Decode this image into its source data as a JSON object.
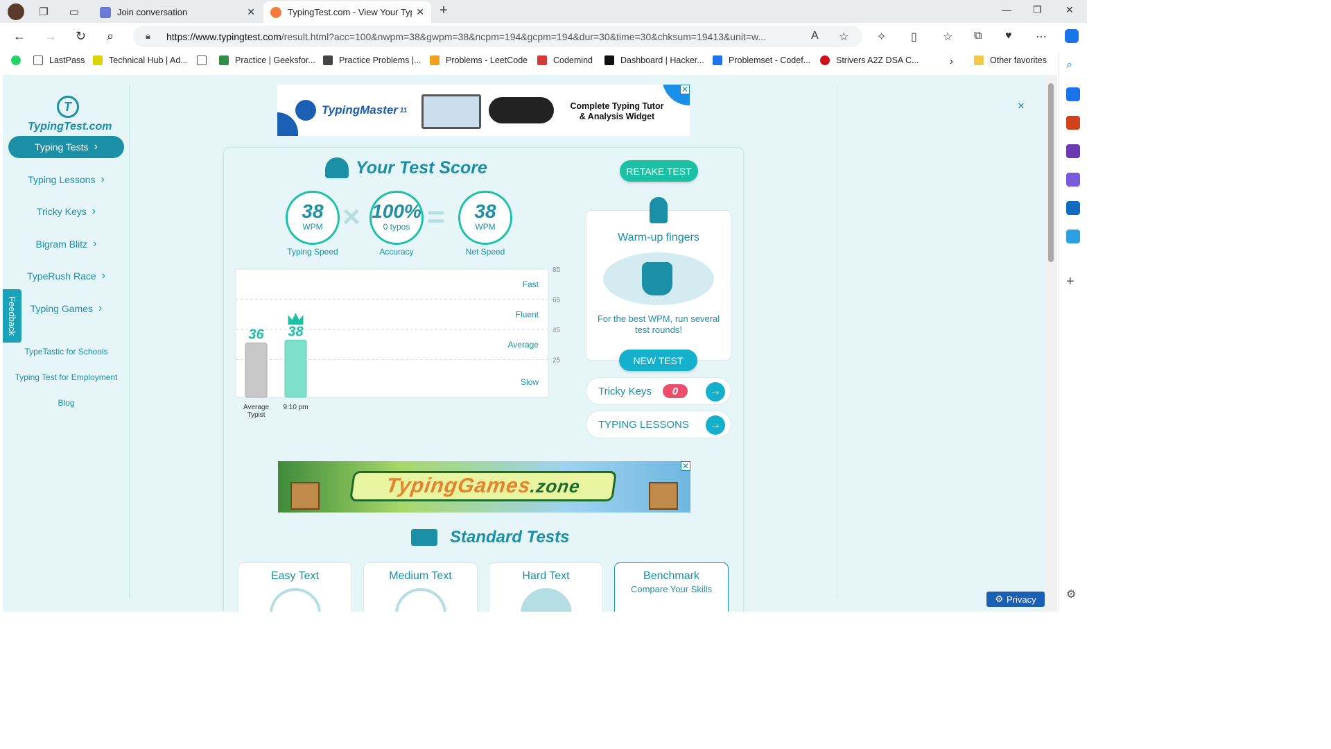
{
  "browser": {
    "tabs": [
      {
        "title": "Join conversation",
        "color": "#6b7ad6"
      },
      {
        "title": "TypingTest.com - View Your Typir",
        "color": "#ef7d3c"
      }
    ],
    "url_domain": "https://www.typingtest.com",
    "url_rest": "/result.html?acc=100&nwpm=38&gwpm=38&ncpm=194&gcpm=194&dur=30&time=30&chksum=19413&unit=w...",
    "bookmarks": [
      {
        "label": "LastPass",
        "color": "#555555"
      },
      {
        "label": "Technical Hub | Ad...",
        "color": "#d8d400"
      },
      {
        "label": "",
        "color": "#777777"
      },
      {
        "label": "Practice | Geeksfor...",
        "color": "#2f8d46"
      },
      {
        "label": "Practice Problems |...",
        "color": "#444444"
      },
      {
        "label": "Problems - LeetCode",
        "color": "#f0a020"
      },
      {
        "label": "Codemind",
        "color": "#d23a3a"
      },
      {
        "label": "Dashboard | Hacker...",
        "color": "#111111"
      },
      {
        "label": "Problemset - Codef...",
        "color": "#1a73e8"
      },
      {
        "label": "Strivers A2Z DSA C...",
        "color": "#d0101a"
      }
    ],
    "other_favorites": "Other favorites"
  },
  "sidebar": {
    "logo_text": "TypingTest.com",
    "logo_letter": "T",
    "items": [
      {
        "label": "Typing Tests",
        "arrow": "›"
      },
      {
        "label": "Typing Lessons",
        "arrow": "›"
      },
      {
        "label": "Tricky Keys",
        "arrow": "›"
      },
      {
        "label": "Bigram Blitz",
        "arrow": "›"
      },
      {
        "label": "TypeRush Race",
        "arrow": "›"
      },
      {
        "label": "Typing Games",
        "arrow": "›"
      }
    ],
    "links": [
      "TypeTastic for Schools",
      "Typing Test for Employment",
      "Blog"
    ],
    "feedback": "Feedback"
  },
  "ad_top": {
    "brand": "TypingMaster",
    "version": "11",
    "copy_line1": "Complete Typing Tutor",
    "copy_line2": "& Analysis Widget"
  },
  "score": {
    "title": "Your Test Score",
    "retake": "RETAKE TEST",
    "stats": [
      {
        "value": "38",
        "unit": "WPM",
        "label": "Typing Speed"
      },
      {
        "value": "100%",
        "unit": "0 typos",
        "label": "Accuracy"
      },
      {
        "value": "38",
        "unit": "WPM",
        "label": "Net Speed"
      }
    ]
  },
  "chart_data": {
    "type": "bar",
    "categories": [
      "Average Typist",
      "9:10 pm"
    ],
    "values": [
      36,
      38
    ],
    "ylim": [
      0,
      85
    ],
    "right_ticks": [
      85,
      65,
      45,
      25
    ],
    "bands": [
      "Fast",
      "Fluent",
      "Average",
      "Slow"
    ],
    "bar_colors": [
      "#c8c8c8",
      "#7ee0c9"
    ],
    "grid": true
  },
  "warmup": {
    "title": "Warm-up fingers",
    "desc": "For the best WPM, run several test rounds!",
    "button": "NEW TEST"
  },
  "links": {
    "tricky_keys": "Tricky Keys",
    "tricky_count": "0",
    "lessons": "TYPING LESSONS"
  },
  "ad_games": {
    "brand": "TypingGames",
    "suffix": ".zone"
  },
  "standard": {
    "title": "Standard Tests",
    "cards": [
      {
        "title": "Easy Text",
        "sub": ""
      },
      {
        "title": "Medium Text",
        "sub": ""
      },
      {
        "title": "Hard Text",
        "sub": ""
      },
      {
        "title": "Benchmark",
        "sub": "Compare Your Skills"
      }
    ]
  },
  "privacy": "Privacy"
}
